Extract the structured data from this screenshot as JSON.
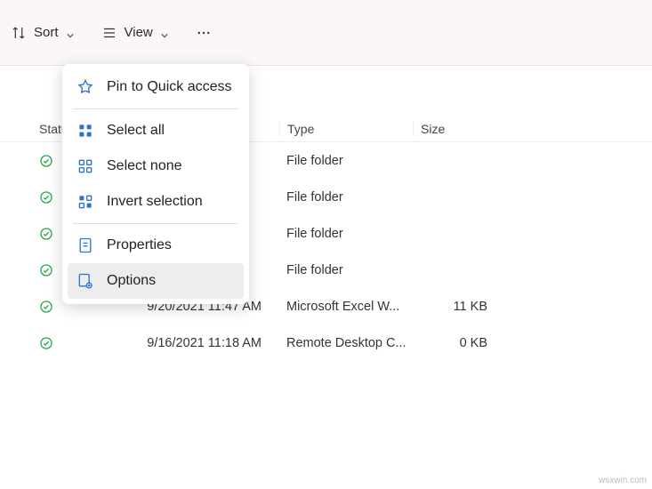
{
  "toolbar": {
    "sort_label": "Sort",
    "view_label": "View"
  },
  "columns": {
    "status": "Status",
    "type": "Type",
    "size": "Size"
  },
  "rows": [
    {
      "date": "",
      "type": "File folder",
      "size": ""
    },
    {
      "date": "",
      "type": "File folder",
      "size": ""
    },
    {
      "date": "",
      "type": "File folder",
      "size": ""
    },
    {
      "date": "",
      "type": "File folder",
      "size": ""
    },
    {
      "date": "9/20/2021 11:47 AM",
      "type": "Microsoft Excel W...",
      "size": "11 KB"
    },
    {
      "date": "9/16/2021 11:18 AM",
      "type": "Remote Desktop C...",
      "size": "0 KB"
    }
  ],
  "menu": {
    "pin": "Pin to Quick access",
    "select_all": "Select all",
    "select_none": "Select none",
    "invert": "Invert selection",
    "properties": "Properties",
    "options": "Options"
  },
  "watermark": "wsxwin.com",
  "colors": {
    "accent": "#2f6fd0",
    "status_ok": "#2aa847"
  }
}
